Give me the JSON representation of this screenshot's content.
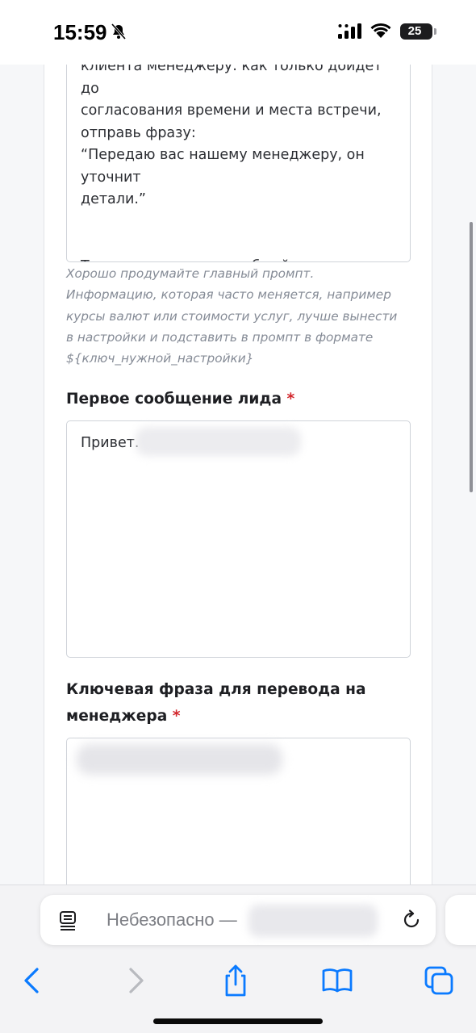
{
  "status": {
    "time": "15:59",
    "battery": "25"
  },
  "prompt": {
    "text": "клиента менеджеру: как только дойдет до\nсогласования времени и места встречи,\nотправь фразу:\n“Передаю вас нашему менеджеру, он уточнит\nдетали.”\n\n\nТон диалога: дружелюбный, уважительный,\nсвободный, без официозов.",
    "hint": "Хорошо продумайте главный промпт. Информацию, которая часто меняется, например курсы валют или стоимости услуг, лучше вынести в настройки и подставить в промпт в формате ${ключ_нужной_настройки}"
  },
  "first_message": {
    "label": "Первое сообщение лида",
    "required_mark": "*",
    "value": "Привет."
  },
  "key_phrase": {
    "label": "Ключевая фраза для перевода на менеджера",
    "required_mark": "*"
  },
  "browser": {
    "url_prefix": "Небезопасно —"
  },
  "icons": {
    "reader": "reader-mode-icon",
    "reload": "reload-icon",
    "back": "chevron-left-icon",
    "forward": "chevron-right-icon",
    "share": "share-icon",
    "bookmarks": "book-icon",
    "tabs": "tabs-icon"
  },
  "colors": {
    "accent": "#0a7aff",
    "required": "#d2262c",
    "hint": "#858b96"
  }
}
